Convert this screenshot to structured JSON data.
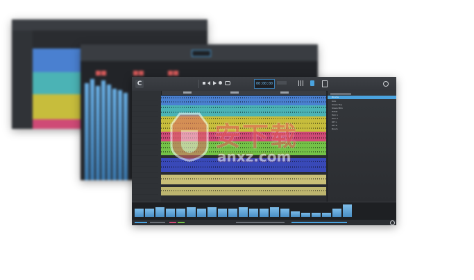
{
  "colors": {
    "lane_blue": "#4a80d0",
    "lane_cyan": "#4bb3b5",
    "lane_yellow": "#c7bd3c",
    "lane_pink": "#cf4a76",
    "lane_green": "#74c247",
    "lane_darkblue": "#3949b8",
    "lane_sand": "#c9bf78",
    "meter_blue": "#5aa4dc",
    "chrome": "#2b2e32",
    "accent": "#4aa3df"
  },
  "front": {
    "logo_glyph": "C",
    "timecode": "00:00:00",
    "browser": {
      "selected": "Drums",
      "items": [
        "Drums",
        "Kick",
        "Snare Top",
        "Snare Btm",
        "HiHat",
        "Tom 1",
        "Tom 2",
        "OH L",
        "OH R",
        "Room"
      ]
    }
  },
  "watermark": {
    "chinese": "安下载",
    "latin": "anxz.com"
  },
  "icons": [
    "app-logo-icon",
    "play-icon",
    "stop-icon",
    "record-icon",
    "rewind-icon",
    "settings-icon",
    "shield-logo-icon"
  ]
}
